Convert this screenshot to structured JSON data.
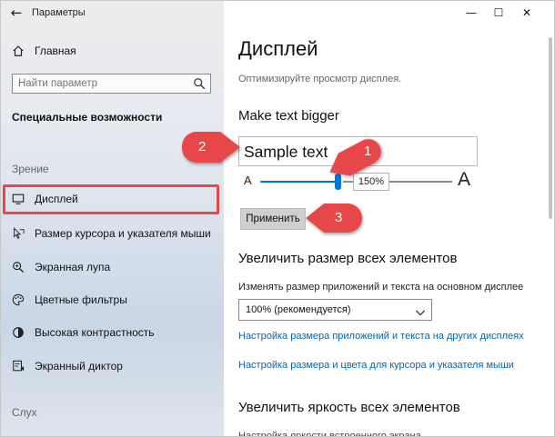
{
  "window": {
    "app_title": "Параметры",
    "back_glyph": "←",
    "controls": {
      "minimize": "—",
      "maximize": "☐",
      "close": "✕"
    }
  },
  "sidebar": {
    "home_label": "Главная",
    "search": {
      "placeholder": "Найти параметр",
      "value": ""
    },
    "section_title": "Специальные возможности",
    "groups": [
      {
        "label": "Зрение"
      },
      {
        "label": "Слух"
      }
    ],
    "items": [
      {
        "label": "Дисплей",
        "icon": "monitor-icon",
        "selected": true
      },
      {
        "label": "Размер курсора и указателя мыши",
        "icon": "cursor-icon"
      },
      {
        "label": "Экранная лупа",
        "icon": "magnifier-icon"
      },
      {
        "label": "Цветные фильтры",
        "icon": "palette-icon"
      },
      {
        "label": "Высокая контрастность",
        "icon": "contrast-icon"
      },
      {
        "label": "Экранный диктор",
        "icon": "narrator-icon"
      }
    ]
  },
  "main": {
    "title": "Дисплей",
    "subtitle": "Оптимизируйте просмотр дисплея.",
    "text_bigger": {
      "heading": "Make text bigger",
      "sample": "Sample text",
      "small_a": "A",
      "large_a": "A",
      "slider_value_label": "150%",
      "slider_fraction": 0.5,
      "apply_label": "Применить"
    },
    "scale": {
      "heading": "Увеличить размер всех элементов",
      "description": "Изменять размер приложений и текста на основном дисплее",
      "selected_option": "100% (рекомендуется)",
      "links": [
        "Настройка размера приложений и текста на других дисплеях",
        "Настройка размера и цвета для курсора и указателя мыши"
      ]
    },
    "brightness": {
      "heading": "Увеличить яркость всех элементов",
      "cut_text": "Настройка яркости встроенного экрана"
    }
  },
  "callouts": [
    {
      "number": "1"
    },
    {
      "number": "2"
    },
    {
      "number": "3"
    }
  ],
  "colors": {
    "accent": "#0078d7",
    "callout": "#e8474a",
    "link": "#0066b4"
  }
}
